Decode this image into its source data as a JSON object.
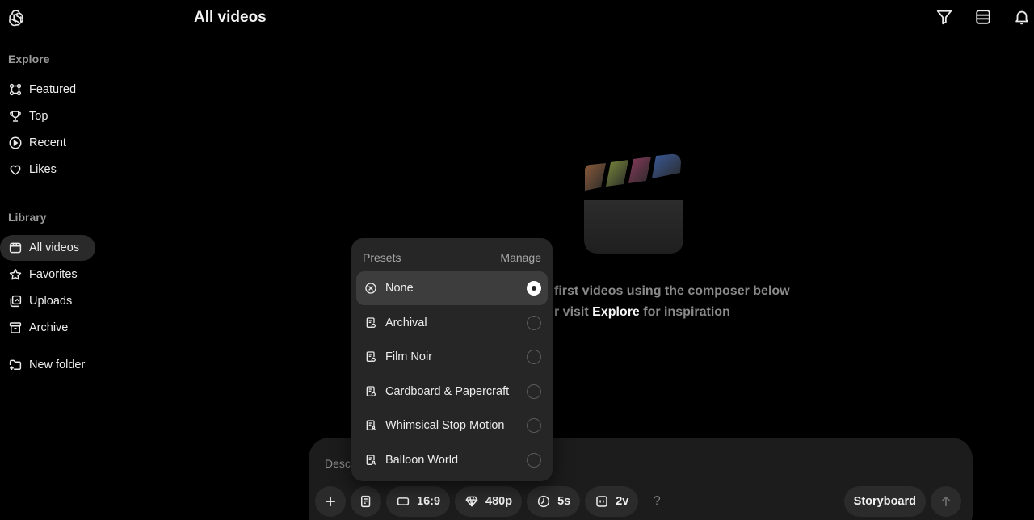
{
  "page": {
    "title": "All videos"
  },
  "top_icons": [
    "filter-icon",
    "layout-icon",
    "bell-icon"
  ],
  "sidebar": {
    "explore_label": "Explore",
    "explore_items": [
      {
        "label": "Featured",
        "icon": "featured-icon"
      },
      {
        "label": "Top",
        "icon": "trophy-icon"
      },
      {
        "label": "Recent",
        "icon": "play-circle-icon"
      },
      {
        "label": "Likes",
        "icon": "heart-icon"
      }
    ],
    "library_label": "Library",
    "library_items": [
      {
        "label": "All videos",
        "icon": "video-library-icon",
        "active": true
      },
      {
        "label": "Favorites",
        "icon": "star-icon"
      },
      {
        "label": "Uploads",
        "icon": "uploads-icon"
      },
      {
        "label": "Archive",
        "icon": "archive-icon"
      }
    ],
    "new_folder_label": "New folder"
  },
  "empty_state": {
    "line1": "first videos using the composer below",
    "line2_prefix": "r visit",
    "line2_link": "Explore",
    "line2_suffix": "for inspiration"
  },
  "composer": {
    "placeholder": "Desc",
    "aspect_ratio": "16:9",
    "resolution": "480p",
    "duration": "5s",
    "variations": "2v",
    "help": "?",
    "storyboard_label": "Storyboard"
  },
  "presets": {
    "title": "Presets",
    "manage_label": "Manage",
    "items": [
      {
        "label": "None",
        "selected": true
      },
      {
        "label": "Archival",
        "selected": false
      },
      {
        "label": "Film Noir",
        "selected": false
      },
      {
        "label": "Cardboard & Papercraft",
        "selected": false
      },
      {
        "label": "Whimsical Stop Motion",
        "selected": false
      },
      {
        "label": "Balloon World",
        "selected": false
      }
    ]
  },
  "colors": {
    "background": "#000000",
    "panel": "#1c1c1c",
    "popover": "#262626",
    "selected_row": "#3d3d3d",
    "active_nav": "#2a2a2a"
  }
}
